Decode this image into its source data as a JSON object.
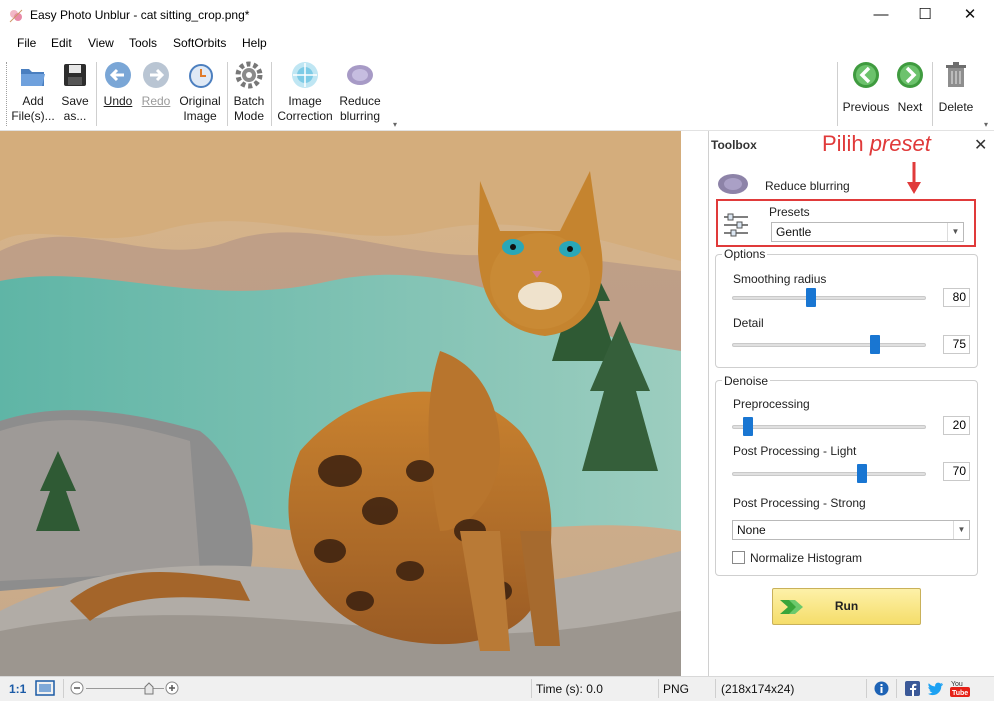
{
  "window": {
    "title": "Easy Photo Unblur - cat sitting_crop.png*",
    "minimize": "—",
    "maximize": "☐",
    "close": "✕"
  },
  "menu": {
    "file": "File",
    "edit": "Edit",
    "view": "View",
    "tools": "Tools",
    "softorbits": "SoftOrbits",
    "help": "Help"
  },
  "toolbar": {
    "add_files": [
      "Add",
      "File(s)..."
    ],
    "save_as": [
      "Save",
      "as..."
    ],
    "undo": "Undo",
    "redo": "Redo",
    "original_image": [
      "Original",
      "Image"
    ],
    "batch_mode": [
      "Batch",
      "Mode"
    ],
    "image_correction": [
      "Image",
      "Correction"
    ],
    "reduce_blurring": [
      "Reduce",
      "blurring"
    ],
    "previous": "Previous",
    "next": "Next",
    "delete": "Delete"
  },
  "toolbox": {
    "title": "Toolbox",
    "close": "✕",
    "annotation_prefix": "Pilih ",
    "annotation_italic": "preset",
    "tool_name": "Reduce blurring",
    "presets_label": "Presets",
    "preset_value": "Gentle",
    "options_title": "Options",
    "smoothing_label": "Smoothing radius",
    "smoothing_value": "80",
    "smoothing_pos": 0.4,
    "detail_label": "Detail",
    "detail_value": "75",
    "detail_pos": 0.75,
    "denoise_title": "Denoise",
    "preprocessing_label": "Preprocessing",
    "preprocessing_value": "20",
    "preprocessing_pos": 0.06,
    "post_light_label": "Post Processing - Light",
    "post_light_value": "70",
    "post_light_pos": 0.68,
    "post_strong_label": "Post Processing - Strong",
    "post_strong_value": "None",
    "normalize_label": "Normalize Histogram",
    "normalize_checked": false,
    "run_label": "Run"
  },
  "status": {
    "zoom_ratio": "1:1",
    "time_label": "Time (s): 0.0",
    "format": "PNG",
    "dimensions": "(218x174x24)"
  },
  "colors": {
    "accent": "#1976d2",
    "annotation": "#e03a3a",
    "run_button": "#f7e27e"
  }
}
